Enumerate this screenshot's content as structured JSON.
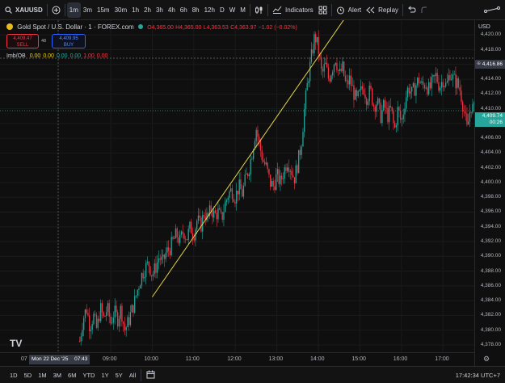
{
  "toolbar": {
    "symbol": "XAUUSD",
    "intervals": [
      "1m",
      "3m",
      "15m",
      "30m",
      "1h",
      "2h",
      "3h",
      "4h",
      "6h",
      "8h",
      "12h",
      "D",
      "W",
      "M"
    ],
    "active_interval": "1m",
    "indicators_label": "Indicators",
    "alert_label": "Alert",
    "replay_label": "Replay"
  },
  "legend": {
    "title": "Gold Spot / U.S. Dollar · 1 · FOREX.com",
    "open": "O4,365.00",
    "high": "H4,365.00",
    "low": "L4,363.53",
    "close": "C4,363.97",
    "change": "−1.02 (−0.02%)",
    "sell_price": "4,409.47",
    "sell_label": "SELL",
    "spread": "48",
    "buy_price": "4,409.95",
    "buy_label": "BUY",
    "indicator_name": "Imb/OB",
    "indicator_values": [
      "0.00",
      "0.00",
      "0.00",
      "0.00",
      "1.00",
      "0.00"
    ],
    "indicator_colors": [
      "#f0d000",
      "#f0d000",
      "#26a69a",
      "#26a69a",
      "#f23645",
      "#f23645"
    ]
  },
  "price_axis": {
    "currency": "USD",
    "labels": [
      "4,420.00",
      "4,418.00",
      "4,416.00",
      "4,414.00",
      "4,412.00",
      "4,410.00",
      "4,408.00",
      "4,406.00",
      "4,404.00",
      "4,402.00",
      "4,400.00",
      "4,398.00",
      "4,396.00",
      "4,394.00",
      "4,392.00",
      "4,390.00",
      "4,388.00",
      "4,386.00",
      "4,384.00",
      "4,382.00",
      "4,380.00",
      "4,378.00"
    ],
    "crosshair_price": "4,416.86",
    "last_price": "4,409.74",
    "countdown": "00:26"
  },
  "time_axis": {
    "left_label": "07",
    "crosshair_date": "Mon 22 Dec '25",
    "crosshair_time": "07:43",
    "labels": [
      "09:00",
      "10:00",
      "11:00",
      "12:00",
      "13:00",
      "14:00",
      "15:00",
      "16:00",
      "17:00"
    ]
  },
  "bottom_bar": {
    "ranges": [
      "1D",
      "5D",
      "1M",
      "3M",
      "6M",
      "YTD",
      "1Y",
      "5Y",
      "All"
    ],
    "clock": "17:42:34 UTC+7"
  },
  "colors": {
    "up": "#26a69a",
    "down": "#f23645",
    "trendline": "#e6d64a",
    "last_price_bg": "#26a69a",
    "background": "#0f0f0f"
  },
  "chart_data": {
    "type": "candlestick",
    "x_range": [
      "08:15",
      "17:45"
    ],
    "ylim": [
      4377,
      4422
    ],
    "trendline": {
      "from": {
        "time": "10:00",
        "price": 4384.5
      },
      "to": {
        "time": "14:40",
        "price": 4422.5
      }
    },
    "path": [
      [
        "08:15",
        4378.5
      ],
      [
        "08:20",
        4381.5
      ],
      [
        "08:25",
        4383
      ],
      [
        "08:30",
        4380.5
      ],
      [
        "08:35",
        4382
      ],
      [
        "08:40",
        4380
      ],
      [
        "08:45",
        4383
      ],
      [
        "08:50",
        4381.5
      ],
      [
        "08:55",
        4383
      ],
      [
        "09:00",
        4381
      ],
      [
        "09:05",
        4382.5
      ],
      [
        "09:10",
        4381.5
      ],
      [
        "09:15",
        4383
      ],
      [
        "09:20",
        4380
      ],
      [
        "09:25",
        4381
      ],
      [
        "09:30",
        4382.5
      ],
      [
        "09:35",
        4384
      ],
      [
        "09:40",
        4386
      ],
      [
        "09:45",
        4387.5
      ],
      [
        "09:50",
        4388.5
      ],
      [
        "09:55",
        4389
      ],
      [
        "10:00",
        4387.5
      ],
      [
        "10:05",
        4388.5
      ],
      [
        "10:10",
        4390
      ],
      [
        "10:15",
        4389
      ],
      [
        "10:20",
        4390.5
      ],
      [
        "10:25",
        4391
      ],
      [
        "10:30",
        4392
      ],
      [
        "10:35",
        4393
      ],
      [
        "10:40",
        4392
      ],
      [
        "10:45",
        4393.5
      ],
      [
        "10:50",
        4392.5
      ],
      [
        "10:55",
        4394
      ],
      [
        "11:00",
        4393
      ],
      [
        "11:05",
        4395
      ],
      [
        "11:10",
        4394
      ],
      [
        "11:15",
        4396
      ],
      [
        "11:20",
        4395
      ],
      [
        "11:25",
        4396.5
      ],
      [
        "11:30",
        4395.5
      ],
      [
        "11:35",
        4396
      ],
      [
        "11:40",
        4395
      ],
      [
        "11:45",
        4397
      ],
      [
        "11:50",
        4398.5
      ],
      [
        "11:55",
        4399
      ],
      [
        "12:00",
        4398
      ],
      [
        "12:05",
        4399.5
      ],
      [
        "12:10",
        4398.5
      ],
      [
        "12:15",
        4400.5
      ],
      [
        "12:20",
        4402
      ],
      [
        "12:25",
        4404.5
      ],
      [
        "12:30",
        4407.5
      ],
      [
        "12:35",
        4405
      ],
      [
        "12:40",
        4403
      ],
      [
        "12:45",
        4402
      ],
      [
        "12:50",
        4400
      ],
      [
        "12:55",
        4399.5
      ],
      [
        "13:00",
        4401
      ],
      [
        "13:05",
        4400
      ],
      [
        "13:10",
        4401.5
      ],
      [
        "13:15",
        4403
      ],
      [
        "13:20",
        4402
      ],
      [
        "13:25",
        4400.5
      ],
      [
        "13:30",
        4402.5
      ],
      [
        "13:35",
        4405
      ],
      [
        "13:40",
        4410
      ],
      [
        "13:45",
        4414
      ],
      [
        "13:50",
        4417
      ],
      [
        "13:55",
        4420
      ],
      [
        "14:00",
        4418
      ],
      [
        "14:05",
        4414.5
      ],
      [
        "14:10",
        4416
      ],
      [
        "14:15",
        4414
      ],
      [
        "14:20",
        4415.5
      ],
      [
        "14:25",
        4417
      ],
      [
        "14:30",
        4414.5
      ],
      [
        "14:35",
        4415.5
      ],
      [
        "14:40",
        4413
      ],
      [
        "14:45",
        4414
      ],
      [
        "14:50",
        4412.5
      ],
      [
        "14:55",
        4411
      ],
      [
        "15:00",
        4412
      ],
      [
        "15:05",
        4413
      ],
      [
        "15:10",
        4411.5
      ],
      [
        "15:15",
        4412.5
      ],
      [
        "15:20",
        4410.5
      ],
      [
        "15:25",
        4411
      ],
      [
        "15:30",
        4409
      ],
      [
        "15:35",
        4410.5
      ],
      [
        "15:40",
        4409
      ],
      [
        "15:45",
        4410
      ],
      [
        "15:50",
        4407
      ],
      [
        "15:55",
        4410
      ],
      [
        "16:00",
        4408
      ],
      [
        "16:05",
        4411
      ],
      [
        "16:10",
        4413
      ],
      [
        "16:15",
        4412
      ],
      [
        "16:20",
        4413
      ],
      [
        "16:25",
        4414
      ],
      [
        "16:30",
        4413
      ],
      [
        "16:35",
        4413.5
      ],
      [
        "16:40",
        4412.5
      ],
      [
        "16:45",
        4413.5
      ],
      [
        "16:50",
        4414.5
      ],
      [
        "16:55",
        4413
      ],
      [
        "17:00",
        4414
      ],
      [
        "17:05",
        4413
      ],
      [
        "17:10",
        4415
      ],
      [
        "17:15",
        4414
      ],
      [
        "17:20",
        4413.5
      ],
      [
        "17:25",
        4412.5
      ],
      [
        "17:30",
        4410
      ],
      [
        "17:35",
        4407
      ],
      [
        "17:40",
        4410.5
      ],
      [
        "17:45",
        4409.74
      ]
    ]
  }
}
